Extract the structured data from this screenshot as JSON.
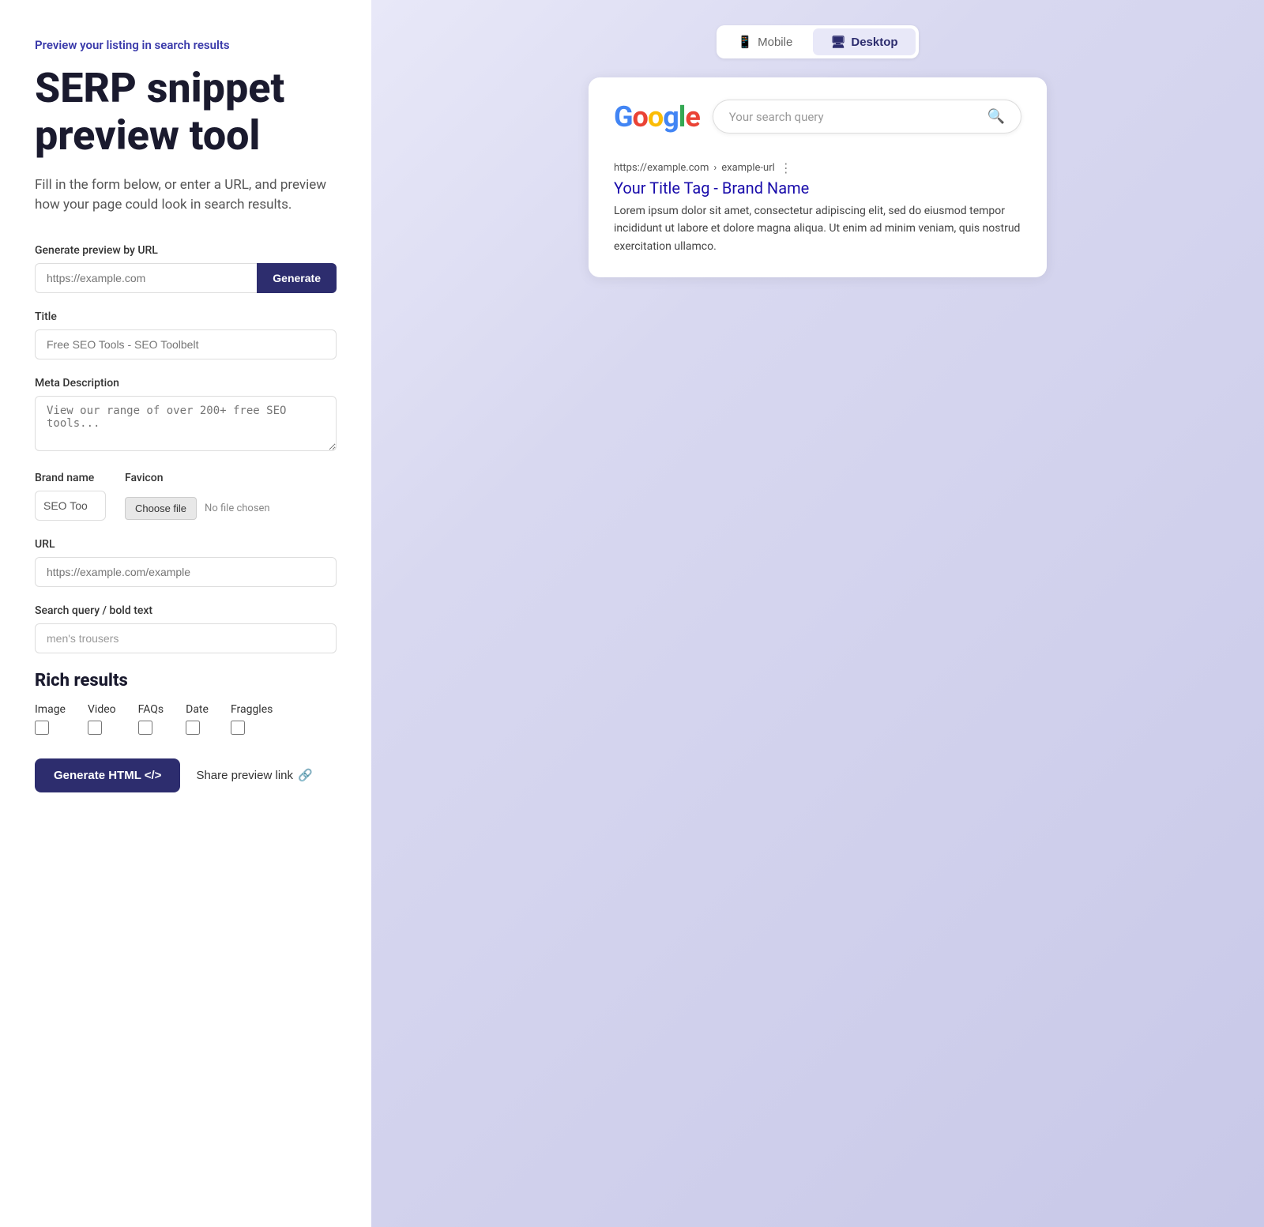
{
  "left": {
    "preview_label": "Preview your listing in search results",
    "title": "SERP snippet preview tool",
    "subtitle": "Fill in the form below, or enter a URL, and preview how your page could look in search results.",
    "url_section": {
      "label": "Generate preview by URL",
      "placeholder": "https://example.com",
      "button": "Generate"
    },
    "title_field": {
      "label": "Title",
      "placeholder": "Free SEO Tools - SEO Toolbelt"
    },
    "meta_description": {
      "label": "Meta Description",
      "placeholder": "View our range of over 200+ free SEO tools..."
    },
    "brand_name": {
      "label": "Brand name",
      "value": "SEO Too"
    },
    "favicon": {
      "label": "Favicon",
      "button": "Choose file",
      "no_file": "No file chosen"
    },
    "url_field": {
      "label": "URL",
      "placeholder": "https://example.com/example"
    },
    "search_query": {
      "label": "Search query / bold text",
      "value": "men's trousers"
    },
    "rich_results": {
      "title": "Rich results",
      "items": [
        {
          "label": "Image"
        },
        {
          "label": "Video"
        },
        {
          "label": "FAQs"
        },
        {
          "label": "Date"
        },
        {
          "label": "Fraggles"
        }
      ]
    },
    "generate_html_btn": "Generate HTML </>",
    "share_link_btn": "Share preview link",
    "share_icon": "🔗"
  },
  "right": {
    "tabs": [
      {
        "label": "Mobile",
        "icon": "📱",
        "active": false
      },
      {
        "label": "Desktop",
        "icon": "🖥",
        "active": true
      }
    ],
    "serp": {
      "search_placeholder": "Your search query",
      "google_letters": [
        "G",
        "o",
        "o",
        "g",
        "l",
        "e"
      ],
      "url": "https://example.com",
      "breadcrumb": "example-url",
      "title": "Your Title Tag - Brand Name",
      "description": "Lorem ipsum dolor sit amet, consectetur adipiscing elit, sed do eiusmod tempor incididunt ut labore et dolore magna aliqua. Ut enim ad minim veniam, quis nostrud exercitation ullamco."
    }
  }
}
